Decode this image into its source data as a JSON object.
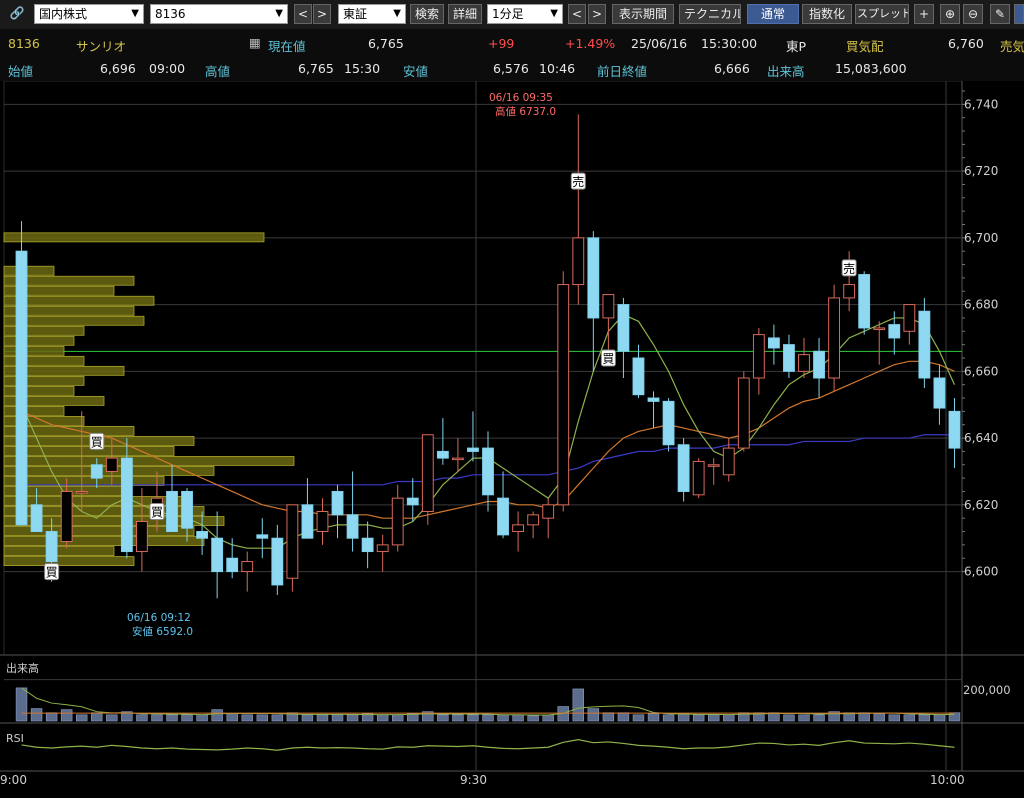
{
  "toolbar": {
    "market": "国内株式",
    "code": "8136",
    "exchange": "東証",
    "search": "検索",
    "detail": "詳細",
    "interval": "1分足",
    "period": "表示期間",
    "technical": "テクニカル",
    "normal": "通常",
    "index": "指数化",
    "spread": "スプレッド",
    "prev": "<",
    "next": ">"
  },
  "quote": {
    "code": "8136",
    "name": "サンリオ",
    "current_label": "現在値",
    "current": "6,765",
    "change": "+99",
    "change_pct": "+1.49%",
    "date": "25/06/16",
    "time": "15:30:00",
    "market": "東P",
    "bid_label": "買気配",
    "bid": "6,760",
    "ask_label": "売気",
    "open_label": "始値",
    "open": "6,696",
    "open_time": "09:00",
    "high_label": "高値",
    "high": "6,765",
    "high_time": "15:30",
    "low_label": "安値",
    "low": "6,576",
    "low_time": "10:46",
    "prev_label": "前日終値",
    "prev_close": "6,666",
    "volume_label": "出来高",
    "volume": "15,083,600"
  },
  "chart_data": {
    "type": "candlestick",
    "price_ticks": [
      "6,740",
      "6,720",
      "6,700",
      "6,680",
      "6,660",
      "6,640",
      "6,620",
      "6,600"
    ],
    "price_tick_values": [
      6740,
      6720,
      6700,
      6680,
      6660,
      6640,
      6620,
      6600
    ],
    "price_range": [
      6575,
      6747
    ],
    "time_labels": [
      "9:00",
      "9:30",
      "10:00"
    ],
    "high_annotation": {
      "time": "06/16 09:35",
      "text": "高値 6737.0",
      "value": 6737
    },
    "low_annotation": {
      "time": "06/16 09:12",
      "text": "安値 6592.0",
      "value": 6592
    },
    "reference_line": 6666,
    "volume_title": "出来高",
    "volume_tick": "200,000",
    "volume_tick_value": 200000,
    "volume_max": 290000,
    "rsi_title": "RSI",
    "candles": [
      [
        6696,
        6705,
        6614,
        6614
      ],
      [
        6620,
        6625,
        6612,
        6612
      ],
      [
        6612,
        6616,
        6597,
        6603
      ],
      [
        6609,
        6628,
        6607,
        6624
      ],
      [
        6624,
        6648,
        6618,
        6624
      ],
      [
        6632,
        6634,
        6625,
        6628
      ],
      [
        6630,
        6640,
        6626,
        6634
      ],
      [
        6634,
        6640,
        6604,
        6606
      ],
      [
        6606,
        6625,
        6600,
        6615
      ],
      [
        6616,
        6630,
        6612,
        6622
      ],
      [
        6624,
        6632,
        6618,
        6612
      ],
      [
        6624,
        6625,
        6609,
        6613
      ],
      [
        6612,
        6618,
        6605,
        6610
      ],
      [
        6610,
        6618,
        6592,
        6600
      ],
      [
        6604,
        6610,
        6598,
        6600
      ],
      [
        6600,
        6606,
        6594,
        6603
      ],
      [
        6611,
        6616,
        6604,
        6610
      ],
      [
        6610,
        6614,
        6593,
        6596
      ],
      [
        6598,
        6620,
        6594,
        6620
      ],
      [
        6620,
        6628,
        6612,
        6610
      ],
      [
        6612,
        6622,
        6608,
        6618
      ],
      [
        6624,
        6626,
        6610,
        6617
      ],
      [
        6617,
        6630,
        6606,
        6610
      ],
      [
        6610,
        6615,
        6601,
        6606
      ],
      [
        6606,
        6611,
        6600,
        6608
      ],
      [
        6608,
        6626,
        6606,
        6622
      ],
      [
        6622,
        6628,
        6615,
        6620
      ],
      [
        6618,
        6640,
        6614,
        6641
      ],
      [
        6636,
        6646,
        6632,
        6634
      ],
      [
        6634,
        6640,
        6630,
        6634
      ],
      [
        6637,
        6648,
        6633,
        6636
      ],
      [
        6637,
        6642,
        6618,
        6623
      ],
      [
        6622,
        6630,
        6610,
        6611
      ],
      [
        6612,
        6618,
        6606,
        6614
      ],
      [
        6614,
        6618,
        6610,
        6617
      ],
      [
        6616,
        6622,
        6610,
        6620
      ],
      [
        6620,
        6690,
        6618,
        6686
      ],
      [
        6686,
        6737,
        6680,
        6700
      ],
      [
        6700,
        6702,
        6660,
        6676
      ],
      [
        6676,
        6683,
        6666,
        6683
      ],
      [
        6680,
        6682,
        6658,
        6666
      ],
      [
        6664,
        6668,
        6652,
        6653
      ],
      [
        6652,
        6654,
        6643,
        6651
      ],
      [
        6651,
        6652,
        6636,
        6638
      ],
      [
        6638,
        6640,
        6621,
        6624
      ],
      [
        6623,
        6634,
        6622,
        6633
      ],
      [
        6632,
        6634,
        6626,
        6632
      ],
      [
        6629,
        6640,
        6627,
        6637
      ],
      [
        6637,
        6660,
        6636,
        6658
      ],
      [
        6658,
        6673,
        6653,
        6671
      ],
      [
        6670,
        6674,
        6662,
        6667
      ],
      [
        6668,
        6671,
        6658,
        6660
      ],
      [
        6660,
        6670,
        6658,
        6665
      ],
      [
        6666,
        6670,
        6652,
        6658
      ],
      [
        6658,
        6686,
        6654,
        6682
      ],
      [
        6682,
        6696,
        6678,
        6686
      ],
      [
        6689,
        6690,
        6671,
        6673
      ],
      [
        6673,
        6675,
        6662,
        6673
      ],
      [
        6674,
        6678,
        6665,
        6670
      ],
      [
        6672,
        6680,
        6668,
        6680
      ],
      [
        6678,
        6682,
        6655,
        6658
      ],
      [
        6658,
        6662,
        6644,
        6649
      ],
      [
        6648,
        6652,
        6631,
        6637
      ]
    ],
    "volumes": [
      160000,
      60000,
      40000,
      55000,
      30000,
      40000,
      30000,
      45000,
      30000,
      30000,
      30000,
      30000,
      30000,
      55000,
      35000,
      30000,
      30000,
      30000,
      40000,
      30000,
      30000,
      30000,
      30000,
      35000,
      30000,
      30000,
      35000,
      45000,
      30000,
      30000,
      30000,
      30000,
      30000,
      30000,
      25000,
      30000,
      70000,
      155000,
      60000,
      40000,
      40000,
      30000,
      35000,
      30000,
      35000,
      30000,
      30000,
      30000,
      40000,
      40000,
      40000,
      30000,
      30000,
      30000,
      45000,
      40000,
      40000,
      35000,
      30000,
      30000,
      30000,
      30000,
      40000
    ],
    "ma_fast": [
      6650,
      6640,
      6630,
      6622,
      6618,
      6616,
      6620,
      6622,
      6620,
      6618,
      6617,
      6616,
      6614,
      6610,
      6608,
      6607,
      6607,
      6607,
      6610,
      6612,
      6613,
      6614,
      6614,
      6614,
      6613,
      6613,
      6615,
      6620,
      6626,
      6630,
      6634,
      6634,
      6631,
      6628,
      6625,
      6622,
      6628,
      6645,
      6660,
      6672,
      6677,
      6675,
      6668,
      6660,
      6650,
      6642,
      6636,
      6634,
      6637,
      6643,
      6650,
      6656,
      6659,
      6661,
      6665,
      6670,
      6672,
      6674,
      6676,
      6676,
      6674,
      6666,
      6656
    ],
    "ma_mid": [
      6648,
      6646,
      6644,
      6643,
      6642,
      6641,
      6640,
      6638,
      6636,
      6634,
      6632,
      6630,
      6628,
      6626,
      6624,
      6622,
      6620,
      6619,
      6618,
      6618,
      6617,
      6617,
      6617,
      6617,
      6616,
      6616,
      6616,
      6617,
      6618,
      6619,
      6620,
      6621,
      6621,
      6620,
      6620,
      6619,
      6621,
      6626,
      6631,
      6636,
      6640,
      6642,
      6643,
      6644,
      6643,
      6642,
      6641,
      6640,
      6641,
      6643,
      6646,
      6649,
      6651,
      6652,
      6654,
      6656,
      6658,
      6660,
      6662,
      6663,
      6663,
      6662,
      6660
    ],
    "ma_slow": [
      6626,
      6626,
      6626,
      6626,
      6626,
      6626,
      6626,
      6626,
      6626,
      6626,
      6626,
      6626,
      6626,
      6626,
      6626,
      6626,
      6626,
      6626,
      6626,
      6626,
      6626,
      6626,
      6626,
      6626,
      6626,
      6627,
      6627,
      6627,
      6628,
      6628,
      6629,
      6629,
      6629,
      6629,
      6629,
      6629,
      6630,
      6631,
      6633,
      6634,
      6635,
      6636,
      6636,
      6637,
      6637,
      6637,
      6637,
      6638,
      6638,
      6638,
      6638,
      6638,
      6639,
      6639,
      6639,
      6639,
      6640,
      6640,
      6640,
      6640,
      6641,
      6641,
      6641
    ],
    "volume_profile": [
      [
        6700,
        0.26
      ],
      [
        6690,
        0.05
      ],
      [
        6687,
        0.13
      ],
      [
        6684,
        0.11
      ],
      [
        6681,
        0.15
      ],
      [
        6678,
        0.13
      ],
      [
        6675,
        0.14
      ],
      [
        6672,
        0.08
      ],
      [
        6669,
        0.07
      ],
      [
        6666,
        0.06
      ],
      [
        6663,
        0.08
      ],
      [
        6660,
        0.12
      ],
      [
        6657,
        0.08
      ],
      [
        6654,
        0.07
      ],
      [
        6651,
        0.1
      ],
      [
        6648,
        0.06
      ],
      [
        6645,
        0.08
      ],
      [
        6642,
        0.13
      ],
      [
        6639,
        0.19
      ],
      [
        6636,
        0.17
      ],
      [
        6633,
        0.29
      ],
      [
        6630,
        0.21
      ],
      [
        6627,
        0.16
      ],
      [
        6624,
        0.12
      ],
      [
        6621,
        0.18
      ],
      [
        6618,
        0.2
      ],
      [
        6615,
        0.22
      ],
      [
        6612,
        0.19
      ],
      [
        6609,
        0.2
      ],
      [
        6606,
        0.11
      ],
      [
        6603,
        0.13
      ]
    ],
    "signals": [
      {
        "index": 37,
        "label": "売",
        "value": 6717
      },
      {
        "index": 55,
        "label": "売",
        "value": 6691
      },
      {
        "index": 5,
        "label": "買",
        "value": 6639
      },
      {
        "index": 2,
        "label": "買",
        "value": 6600
      },
      {
        "index": 9,
        "label": "買",
        "value": 6618
      },
      {
        "index": 39,
        "label": "買",
        "value": 6664
      }
    ],
    "rsi": [
      58,
      52,
      50,
      53,
      55,
      52,
      57,
      54,
      50,
      48,
      50,
      47,
      46,
      45,
      47,
      50,
      48,
      44,
      50,
      52,
      50,
      51,
      50,
      48,
      47,
      53,
      52,
      56,
      55,
      54,
      56,
      52,
      49,
      48,
      50,
      52,
      65,
      72,
      64,
      66,
      62,
      57,
      55,
      52,
      48,
      50,
      50,
      53,
      58,
      63,
      62,
      58,
      60,
      57,
      64,
      69,
      63,
      62,
      61,
      63,
      60,
      56,
      52
    ]
  }
}
